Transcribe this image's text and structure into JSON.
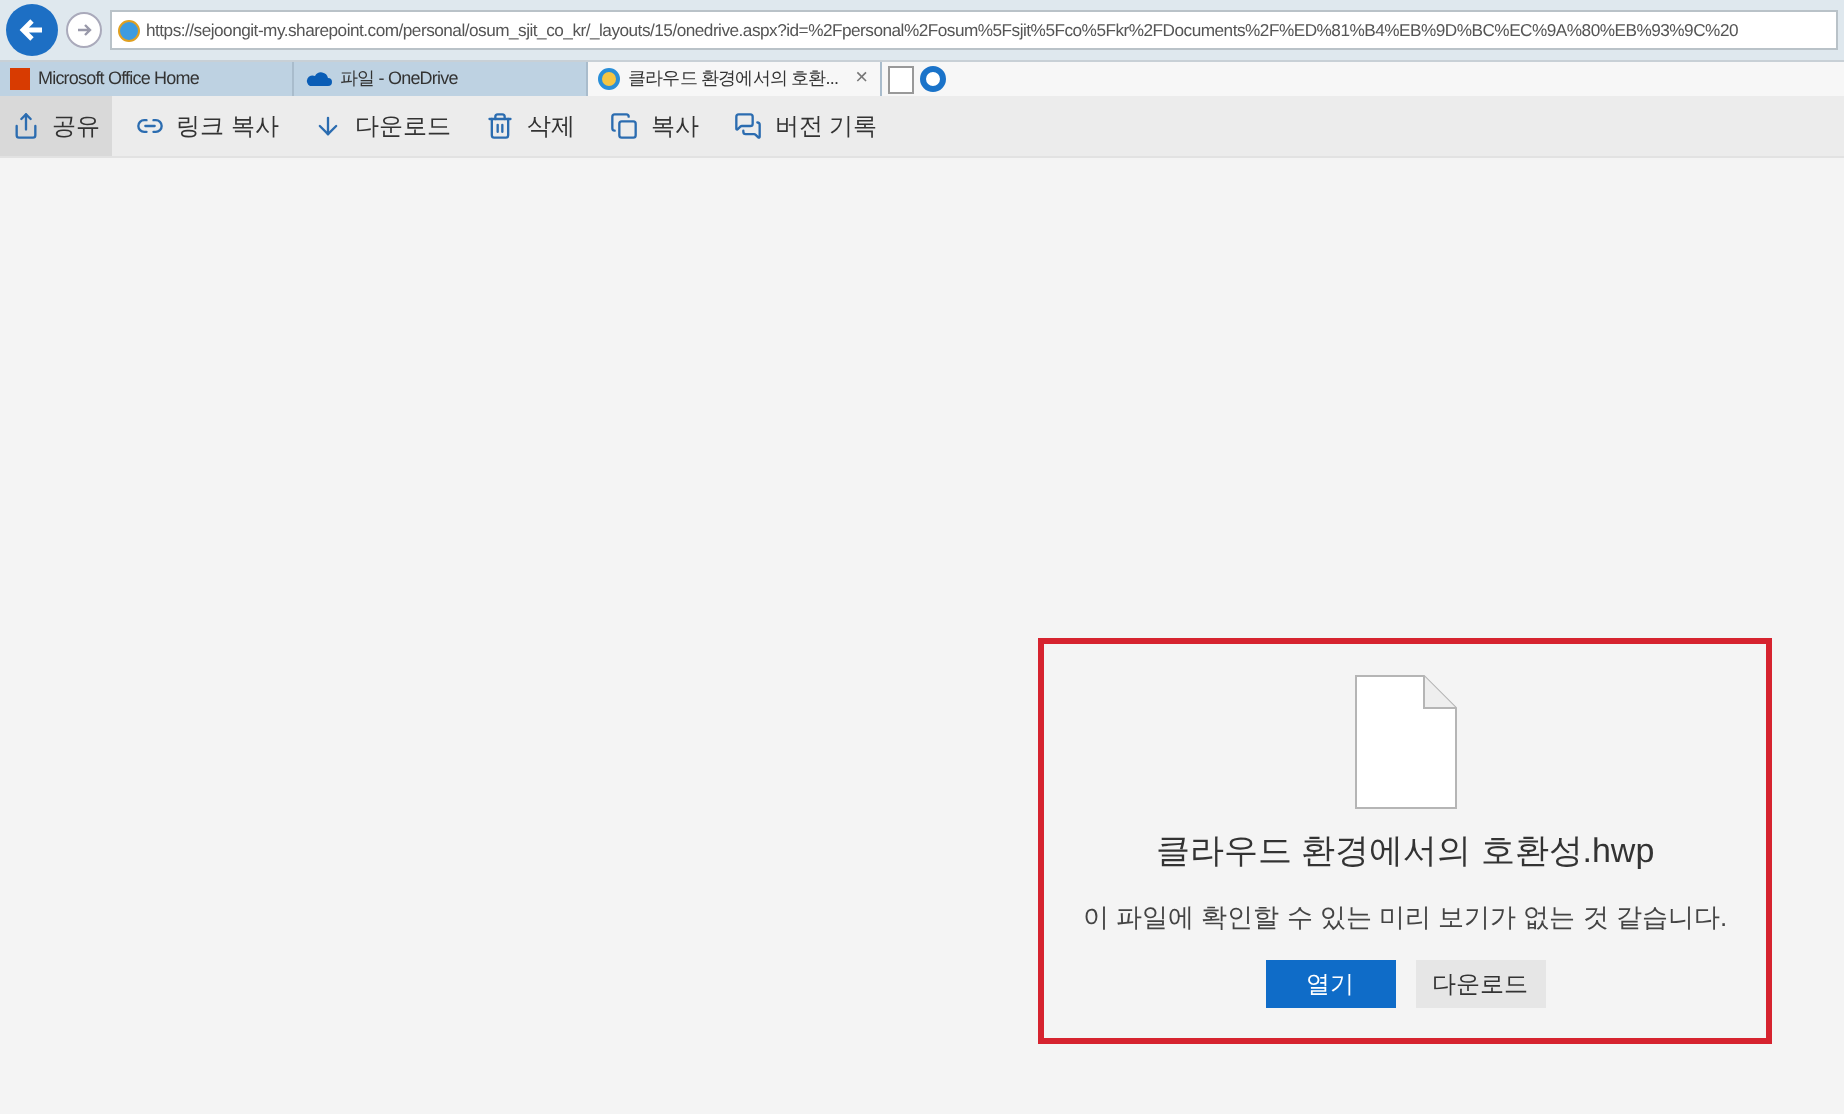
{
  "address_bar": {
    "url": "https://sejoongit-my.sharepoint.com/personal/osum_sjit_co_kr/_layouts/15/onedrive.aspx?id=%2Fpersonal%2Fosum%5Fsjit%5Fco%5Fkr%2FDocuments%2F%ED%81%B4%EB%9D%BC%EC%9A%80%EB%93%9C%20"
  },
  "tabs": [
    {
      "kind": "office",
      "label": "Microsoft Office Home",
      "selected": false
    },
    {
      "kind": "onedrive",
      "label": "파일 - OneDrive",
      "selected": false
    },
    {
      "kind": "ie",
      "label": "클라우드 환경에서의 호환...",
      "selected": true,
      "close": "×"
    }
  ],
  "toolbar": [
    {
      "kind": "share",
      "label": "공유",
      "selected": true
    },
    {
      "kind": "link",
      "label": "링크 복사",
      "selected": false
    },
    {
      "kind": "download",
      "label": "다운로드",
      "selected": false
    },
    {
      "kind": "delete",
      "label": "삭제",
      "selected": false
    },
    {
      "kind": "copy",
      "label": "복사",
      "selected": false
    },
    {
      "kind": "version",
      "label": "버전 기록",
      "selected": false
    }
  ],
  "preview": {
    "highlighted": true,
    "file_name": "클라우드 환경에서의 호환성.hwp",
    "message": "이 파일에 확인할 수 있는 미리 보기가 없는 것 같습니다.",
    "buttons": [
      {
        "kind": "primary",
        "label": "열기"
      },
      {
        "kind": "secondary",
        "label": "다운로드"
      }
    ]
  }
}
